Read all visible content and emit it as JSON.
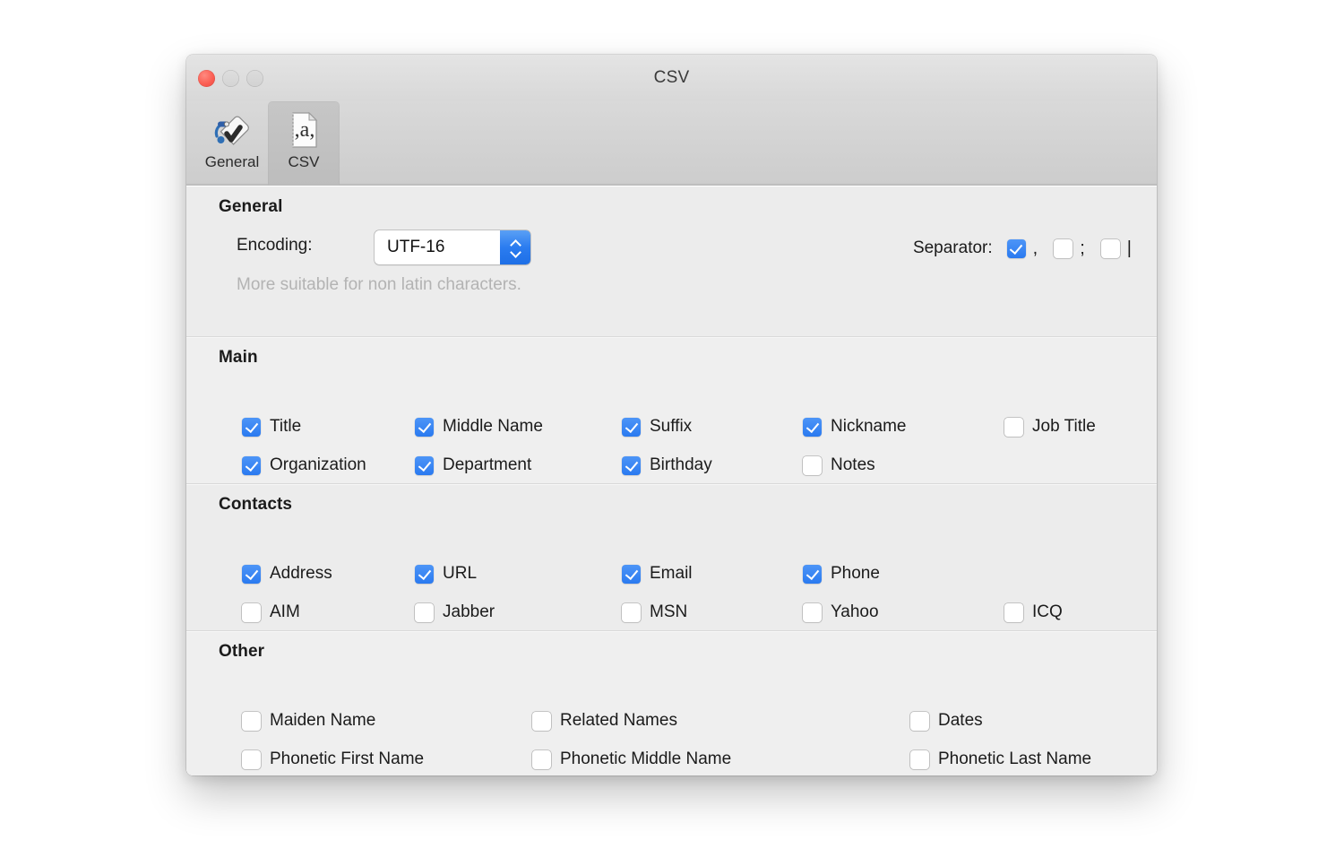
{
  "window": {
    "title": "CSV",
    "traffic_lights": [
      "close",
      "minimize",
      "zoom"
    ]
  },
  "toolbar": {
    "items": [
      {
        "label": "General",
        "icon": "tag-checkmark-icon",
        "selected": false
      },
      {
        "label": "CSV",
        "icon": "csv-document-icon",
        "selected": true
      }
    ]
  },
  "sections": {
    "general": {
      "title": "General",
      "encoding_label": "Encoding:",
      "encoding_value": "UTF-16",
      "hint": "More suitable for non latin characters.",
      "separator_label": "Separator:",
      "separators": [
        {
          "glyph": ",",
          "name": "comma",
          "checked": true
        },
        {
          "glyph": ";",
          "name": "semicolon",
          "checked": false
        },
        {
          "glyph": "|",
          "name": "pipe",
          "checked": false
        }
      ]
    },
    "main": {
      "title": "Main",
      "fields": [
        {
          "label": "Title",
          "checked": true,
          "col": 0,
          "row": 0
        },
        {
          "label": "Middle Name",
          "checked": true,
          "col": 1,
          "row": 0
        },
        {
          "label": "Suffix",
          "checked": true,
          "col": 2,
          "row": 0
        },
        {
          "label": "Nickname",
          "checked": true,
          "col": 3,
          "row": 0
        },
        {
          "label": "Job Title",
          "checked": false,
          "col": 4,
          "row": 0
        },
        {
          "label": "Organization",
          "checked": true,
          "col": 0,
          "row": 1
        },
        {
          "label": "Department",
          "checked": true,
          "col": 1,
          "row": 1
        },
        {
          "label": "Birthday",
          "checked": true,
          "col": 2,
          "row": 1
        },
        {
          "label": "Notes",
          "checked": false,
          "col": 3,
          "row": 1
        }
      ]
    },
    "contacts": {
      "title": "Contacts",
      "fields": [
        {
          "label": "Address",
          "checked": true,
          "col": 0,
          "row": 0
        },
        {
          "label": "URL",
          "checked": true,
          "col": 1,
          "row": 0
        },
        {
          "label": "Email",
          "checked": true,
          "col": 2,
          "row": 0
        },
        {
          "label": "Phone",
          "checked": true,
          "col": 3,
          "row": 0
        },
        {
          "label": "AIM",
          "checked": false,
          "col": 0,
          "row": 1
        },
        {
          "label": "Jabber",
          "checked": false,
          "col": 1,
          "row": 1
        },
        {
          "label": "MSN",
          "checked": false,
          "col": 2,
          "row": 1
        },
        {
          "label": "Yahoo",
          "checked": false,
          "col": 3,
          "row": 1
        },
        {
          "label": "ICQ",
          "checked": false,
          "col": 4,
          "row": 1
        }
      ]
    },
    "other": {
      "title": "Other",
      "fields": [
        {
          "label": "Maiden Name",
          "checked": false,
          "col": 0,
          "row": 0
        },
        {
          "label": "Related Names",
          "checked": false,
          "col": 1,
          "row": 0
        },
        {
          "label": "Dates",
          "checked": false,
          "col": 2,
          "row": 0
        },
        {
          "label": "Phonetic First Name",
          "checked": false,
          "col": 0,
          "row": 1
        },
        {
          "label": "Phonetic Middle Name",
          "checked": false,
          "col": 1,
          "row": 1
        },
        {
          "label": "Phonetic Last Name",
          "checked": false,
          "col": 2,
          "row": 1
        }
      ]
    }
  },
  "colors": {
    "accent": "#2a7af0",
    "window_bg": "#ececec",
    "toolbar_bg": "#d3d3d3",
    "close_button": "#fb5e53",
    "hint_text": "#b3b3b3"
  },
  "layout": {
    "columns_5": [
      26,
      219,
      450,
      652,
      877
    ],
    "columns_3": [
      26,
      350,
      772
    ],
    "row_offsets": [
      55,
      98
    ]
  }
}
